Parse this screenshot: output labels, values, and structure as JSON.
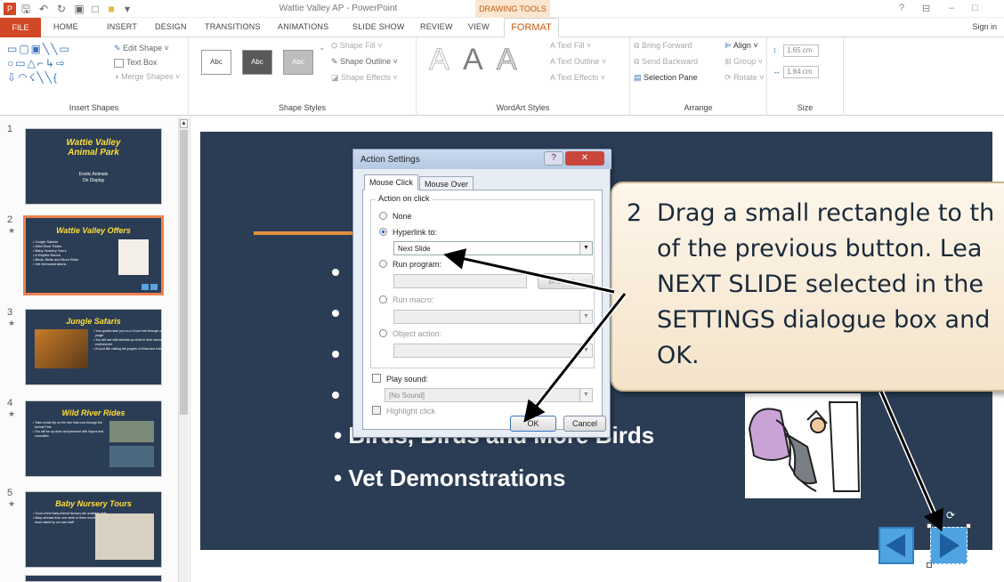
{
  "app_title": "Wattie Valley AP - PowerPoint",
  "contextual_tab": "DRAWING TOOLS",
  "window_controls": {
    "help": "?",
    "ribbon": "⊟",
    "min": "–",
    "max": "□"
  },
  "tabs": [
    "FILE",
    "HOME",
    "INSERT",
    "DESIGN",
    "TRANSITIONS",
    "ANIMATIONS",
    "SLIDE SHOW",
    "REVIEW",
    "VIEW",
    "FORMAT"
  ],
  "signin": "Sign in",
  "ribbon": {
    "insert_shapes": {
      "label": "Insert Shapes",
      "edit_shape": "Edit Shape ˅",
      "text_box": "Text Box",
      "merge_shapes": "Merge Shapes ˅"
    },
    "shape_styles": {
      "label": "Shape Styles",
      "sample": "Abc",
      "fill": "Shape Fill ˅",
      "outline": "Shape Outline ˅",
      "effects": "Shape Effects ˅"
    },
    "wordart": {
      "label": "WordArt Styles",
      "letter": "A",
      "text_fill": "Text Fill ˅",
      "text_outline": "Text Outline ˅",
      "text_effects": "Text Effects ˅"
    },
    "arrange": {
      "label": "Arrange",
      "bring_forward": "Bring Forward",
      "send_backward": "Send Backward",
      "selection_pane": "Selection Pane",
      "align": "Align ˅",
      "group": "Group ˅",
      "rotate": "Rotate ˅"
    },
    "size": {
      "label": "Size",
      "height": "1.65 cm",
      "width": "1.84 cm"
    }
  },
  "thumbnails": [
    {
      "num": "1",
      "star": "",
      "title": "Wattie Valley\nAnimal Park",
      "sub": "Exotic Animals\nOn Display"
    },
    {
      "num": "2",
      "star": "★",
      "title": "Wattie Valley Offers",
      "sub": "• Jungle Safaris\n• Wild River Rides\n• Baby Nursery Tours\n• A Reptile Ranch\n• Birds, Birds and More Birds\n• Vet Demonstrations"
    },
    {
      "num": "3",
      "star": "★",
      "title": "Jungle Safaris",
      "sub": "• Your guides take you on a 3 hour trek through our own\n  jungle\n• You will see wild animals up close in their natural\n  environment\n• It's just like visiting the jungles of Africa and India"
    },
    {
      "num": "4",
      "star": "★",
      "title": "Wild River Rides",
      "sub": "• Take a boat trip on the river that runs through the\n  Animal Park\n• You will be up close and personal with hippos and\n  crocodiles"
    },
    {
      "num": "5",
      "star": "★",
      "title": "Baby Nursery Tours",
      "sub": "• Tours of the Baby Animal Nursery are available daily\n• Baby animals from one week to three months of age are\n  hand raised by our own staff"
    }
  ],
  "slide": {
    "bullets": [
      "• Birds, Birds and More Birds",
      "• Vet Demonstrations"
    ]
  },
  "dialog": {
    "title": "Action Settings",
    "help": "?",
    "close": "✕",
    "tab_mouse_click": "Mouse Click",
    "tab_mouse_over": "Mouse Over",
    "group": "Action on click",
    "none": "None",
    "hyperlink": "Hyperlink to:",
    "hyperlink_value": "Next Slide",
    "run_program": "Run program:",
    "browse": "Browse...",
    "run_macro": "Run macro:",
    "object_action": "Object action:",
    "play_sound": "Play sound:",
    "sound_value": "[No Sound]",
    "highlight": "Highlight click",
    "ok": "OK",
    "cancel": "Cancel"
  },
  "callout": {
    "step": "2",
    "lines": [
      "Drag a small rectangle to th",
      "of the previous button.  Lea",
      "NEXT SLIDE selected in the",
      "SETTINGS dialogue box and",
      "OK."
    ]
  }
}
